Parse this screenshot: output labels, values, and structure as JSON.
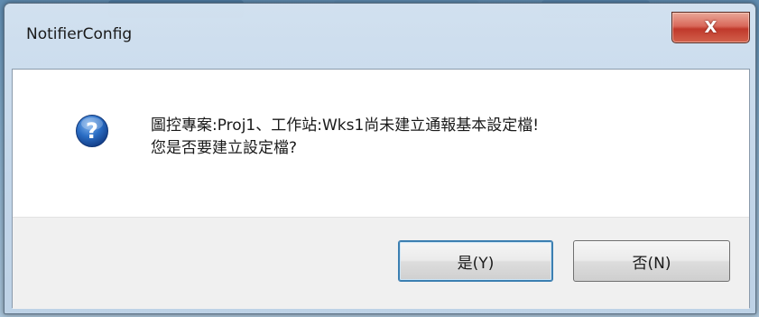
{
  "window": {
    "title": "NotifierConfig",
    "close_glyph": "X"
  },
  "message": {
    "line1": "圖控專案:Proj1、工作站:Wks1尚未建立通報基本設定檔!",
    "line2": "您是否要建立設定檔?"
  },
  "icon": {
    "name": "question-icon",
    "glyph": "?"
  },
  "buttons": {
    "yes_label": "是(Y)",
    "no_label": "否(N)"
  },
  "colors": {
    "close_red": "#c0392b",
    "icon_blue": "#1f5fb5",
    "footer_gray": "#f0f0f0",
    "default_focus": "#3c7fb1"
  }
}
